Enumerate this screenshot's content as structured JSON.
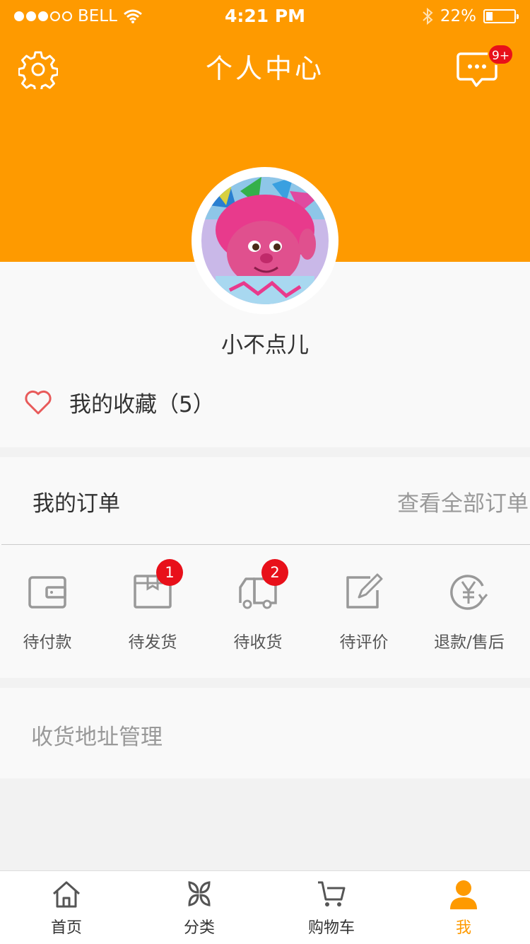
{
  "status_bar": {
    "carrier": "BELL",
    "time": "4:21 PM",
    "battery": "22%",
    "battery_level": 0.22
  },
  "header": {
    "title": "个人中心",
    "message_badge": "9+"
  },
  "profile": {
    "username": "小不点儿",
    "favorites_label": "我的收藏（5）"
  },
  "orders": {
    "title": "我的订单",
    "view_all": "查看全部订单",
    "items": [
      {
        "label": "待付款",
        "badge": "",
        "icon": "wallet-icon"
      },
      {
        "label": "待发货",
        "badge": "1",
        "icon": "package-icon"
      },
      {
        "label": "待收货",
        "badge": "2",
        "icon": "truck-icon"
      },
      {
        "label": "待评价",
        "badge": "",
        "icon": "edit-icon"
      },
      {
        "label": "退款/售后",
        "badge": "",
        "icon": "yuan-refund-icon"
      }
    ]
  },
  "address": {
    "label": "收货地址管理"
  },
  "tabbar": {
    "items": [
      {
        "label": "首页",
        "icon": "home-icon"
      },
      {
        "label": "分类",
        "icon": "category-icon"
      },
      {
        "label": "购物车",
        "icon": "cart-icon"
      },
      {
        "label": "我",
        "icon": "user-icon",
        "active": true
      }
    ]
  },
  "colors": {
    "accent": "#fe9a00",
    "badge": "#e8101a",
    "page_bg": "#f2f2f2",
    "card_bg": "#f9f9f9"
  }
}
